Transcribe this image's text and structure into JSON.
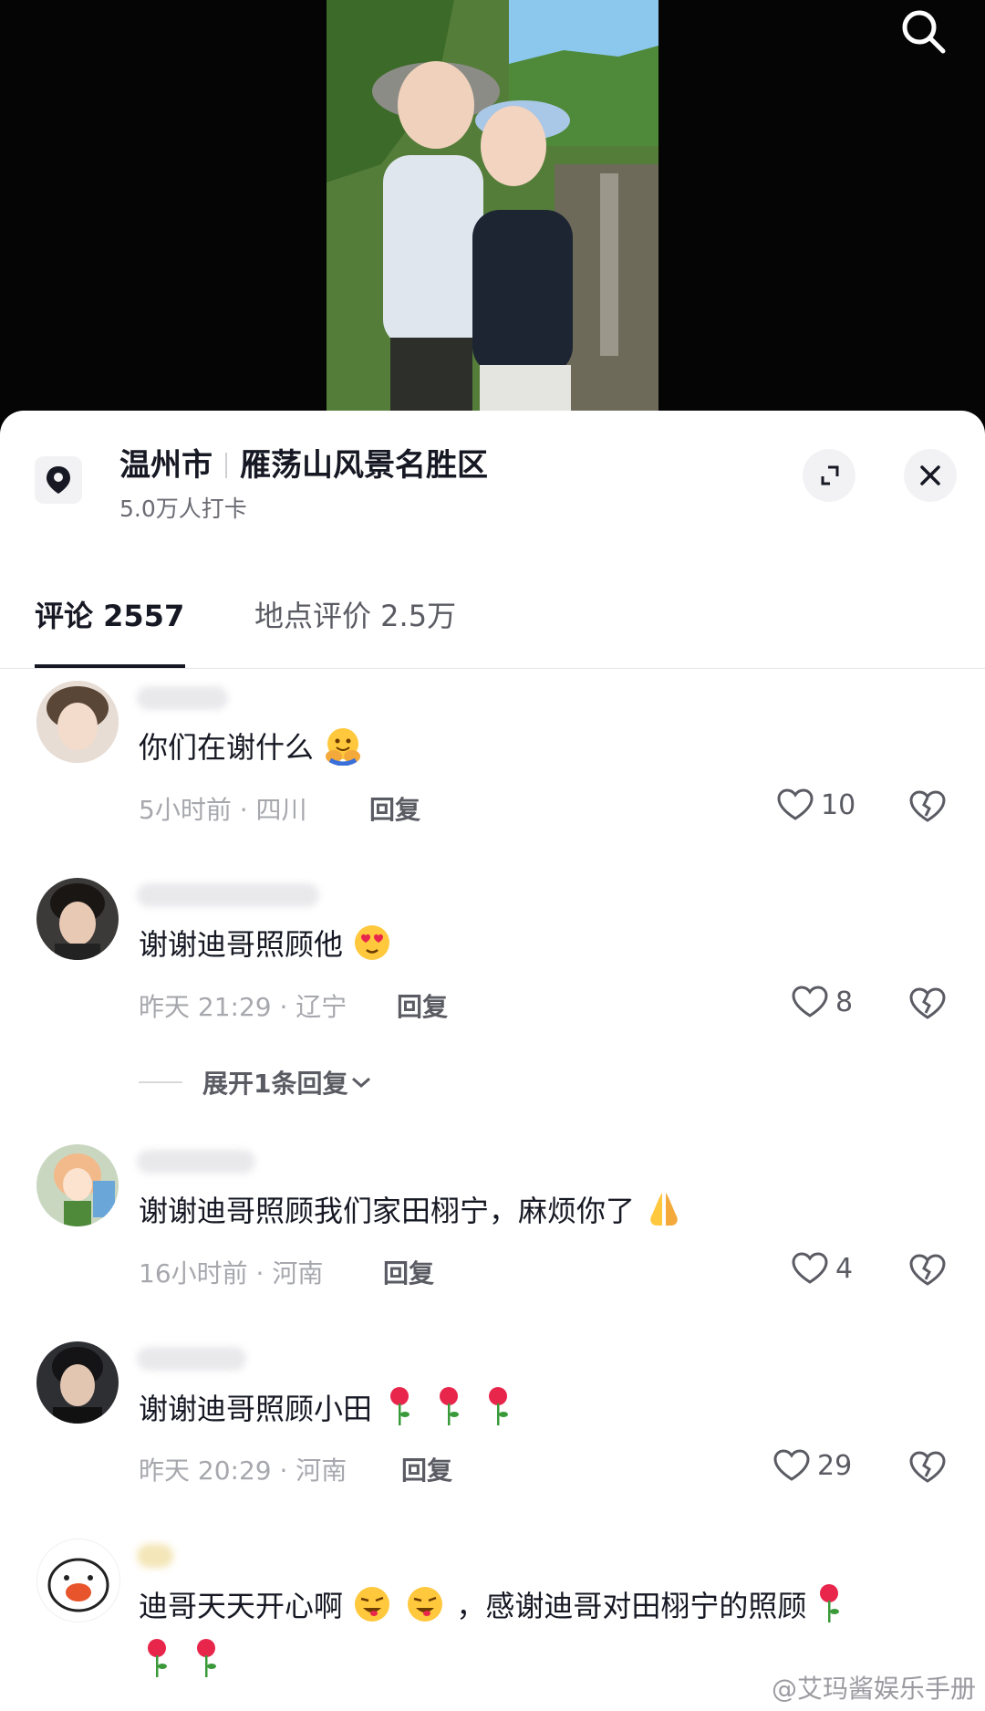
{
  "location": {
    "city": "温州市",
    "spot": "雁荡山风景名胜区",
    "checkins": "5.0万人打卡"
  },
  "tabs": [
    {
      "label": "评论 2557",
      "active": true
    },
    {
      "label": "地点评价 2.5万",
      "active": false
    }
  ],
  "comments": [
    {
      "text": "你们在谢什么",
      "emoji": "hug-emoji",
      "meta": "5小时前 · 四川",
      "reply": "回复",
      "likes": "10"
    },
    {
      "text": "谢谢迪哥照顾他",
      "emoji": "heart-eyes-emoji",
      "meta": "昨天 21:29 · 辽宁",
      "reply": "回复",
      "likes": "8",
      "expand": "展开1条回复"
    },
    {
      "text": "谢谢迪哥照顾我们家田栩宁，麻烦你了",
      "emoji": "pray-emoji",
      "meta": "16小时前 · 河南",
      "reply": "回复",
      "likes": "4"
    },
    {
      "text": "谢谢迪哥照顾小田",
      "emoji": "rose-emoji",
      "meta": "昨天 20:29 · 河南",
      "reply": "回复",
      "likes": "29"
    },
    {
      "text_a": "迪哥天天开心啊",
      "text_b": "，感谢迪哥对田栩宁的照顾",
      "emoji": "wink-tongue-emoji"
    }
  ],
  "watermark": "@艾玛酱娱乐手册",
  "colors": {
    "accent": "#161823",
    "muted": "#a7a8ae",
    "sheet": "#ffffff"
  }
}
